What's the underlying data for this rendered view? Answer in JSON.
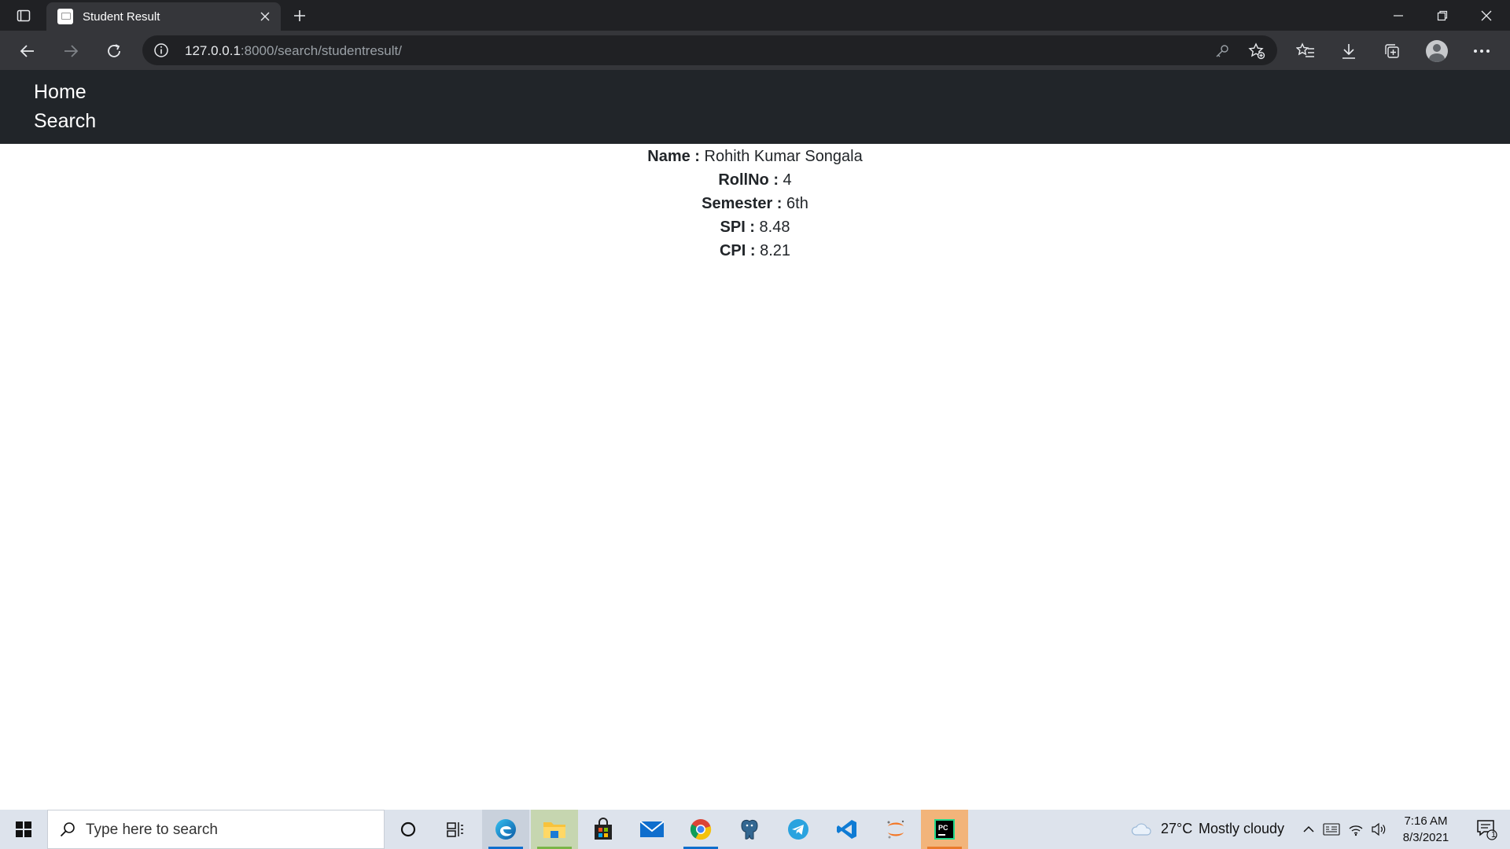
{
  "browser": {
    "tab_title": "Student Result",
    "url_host": "127.0.0.1",
    "url_rest": ":8000/search/studentresult/"
  },
  "site_nav": {
    "home": "Home",
    "search": "Search"
  },
  "result": {
    "name_label": "Name :",
    "name_value": "Rohith Kumar Songala",
    "rollno_label": "RollNo :",
    "rollno_value": "4",
    "semester_label": "Semester :",
    "semester_value": "6th",
    "spi_label": "SPI :",
    "spi_value": "8.48",
    "cpi_label": "CPI :",
    "cpi_value": "8.21"
  },
  "taskbar": {
    "search_placeholder": "Type here to search",
    "weather_temp": "27°C",
    "weather_desc": "Mostly cloudy",
    "time": "7:16 AM",
    "date": "8/3/2021",
    "notification_count": "1"
  },
  "colors": {
    "site_nav_bg": "#212529",
    "browser_frame": "#202124",
    "taskbar_bg": "#dde3ec",
    "accent": "#0f6ecd"
  },
  "icons": {
    "browser": [
      "tab-actions-icon",
      "close-icon",
      "plus-icon",
      "minimize-icon",
      "restore-icon",
      "back-icon",
      "forward-icon",
      "reload-icon",
      "info-icon",
      "key-icon",
      "add-favorite-icon",
      "favorites-icon",
      "download-icon",
      "collections-icon",
      "profile-icon",
      "more-icon"
    ],
    "taskbar": [
      "windows-icon",
      "search-icon",
      "cortana-icon",
      "task-view-icon",
      "edge-icon",
      "file-explorer-icon",
      "store-icon",
      "mail-icon",
      "chrome-icon",
      "postgres-icon",
      "telegram-icon",
      "vscode-icon",
      "jupyter-icon",
      "pycharm-icon",
      "cloud-icon",
      "chevron-up-icon",
      "input-method-icon",
      "wifi-icon",
      "volume-icon",
      "notification-icon"
    ]
  }
}
